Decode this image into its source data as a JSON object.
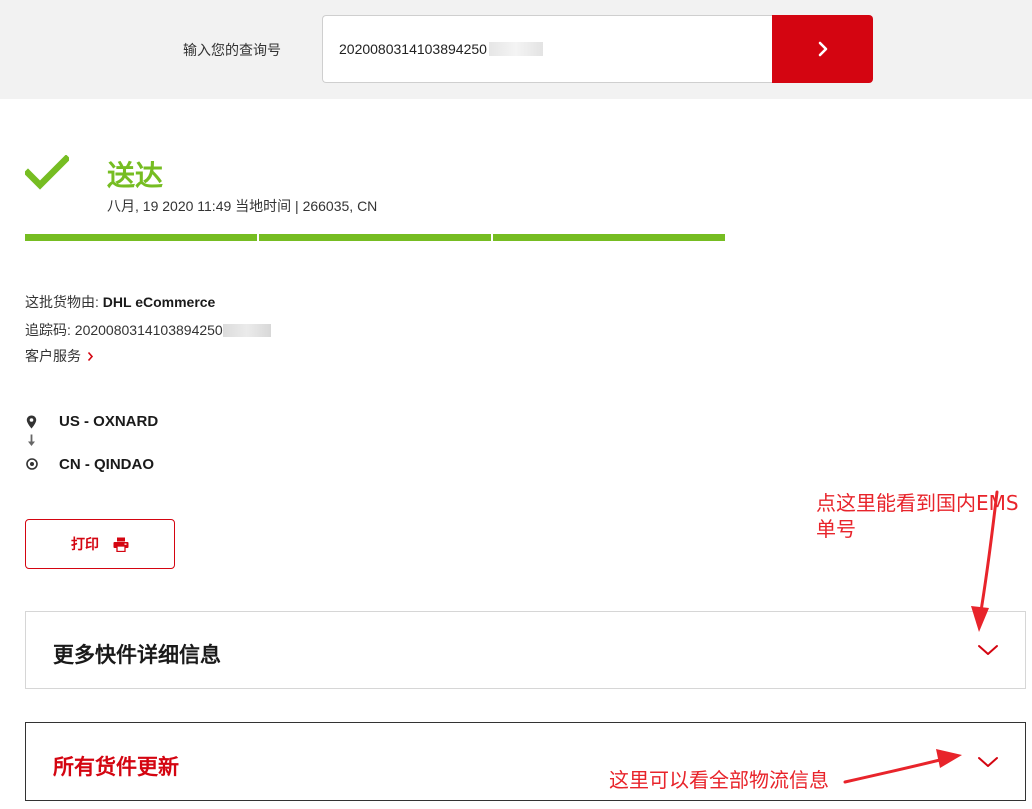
{
  "search": {
    "label": "输入您的查询号",
    "value": "2020080314103894250"
  },
  "status": {
    "title": "送达",
    "subtitle": "八月, 19 2020 11:49 当地时间 | 266035, CN",
    "progress_segments_complete": 3,
    "progress_segments_total": 3,
    "color": "#76bd22"
  },
  "shipment": {
    "carrier_label": "这批货物由: ",
    "carrier_name": "DHL eCommerce",
    "tracking_label": "追踪码: ",
    "tracking_number": "2020080314103894250",
    "customer_service": "客户服务"
  },
  "route": {
    "origin": "US - OXNARD",
    "destination": "CN - QINDAO"
  },
  "print": {
    "label": "打印"
  },
  "panels": {
    "more_details": "更多快件详细信息",
    "all_updates": "所有货件更新"
  },
  "annotations": {
    "note_1": "点这里能看到国内EMS单号",
    "note_2": "这里可以看全部物流信息"
  },
  "colors": {
    "brand_red": "#d40511",
    "annotation_red": "#e8242b",
    "success_green": "#76bd22"
  },
  "icons": {
    "search_submit": "chevron-right-icon",
    "status": "checkmark-icon",
    "origin": "location-pin-icon",
    "route": "arrow-down-icon",
    "destination": "target-icon",
    "print": "printer-icon",
    "expand": "chevron-down-icon"
  }
}
